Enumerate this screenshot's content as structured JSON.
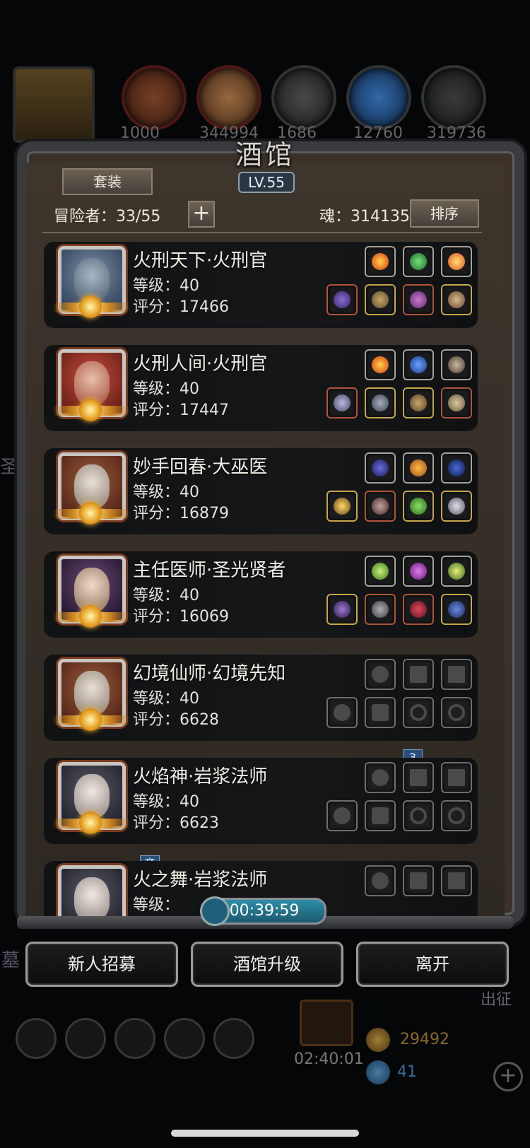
{
  "background": {
    "resources": [
      "1000",
      "344994",
      "1686",
      "12760",
      "319736"
    ],
    "side_text_left": "墓",
    "side_text_left2": "圣",
    "side_text_right": "出征",
    "gold": "29492",
    "gem": "41",
    "gift_timer": "02:40:01"
  },
  "tavern": {
    "title": "酒馆",
    "level": "LV.55",
    "set_button": "套装",
    "adventurers_label": "冒险者：33/55",
    "soul_label": "魂：314135",
    "sort_button": "排序",
    "timer": "00:39:59"
  },
  "heroes": [
    {
      "name": "火刑天下·火刑官",
      "level": "等级：40",
      "score": "评分：17466",
      "equipped": true
    },
    {
      "name": "火刑人间·火刑官",
      "level": "等级：40",
      "score": "评分：17447",
      "equipped": true
    },
    {
      "name": "妙手回春·大巫医",
      "level": "等级：40",
      "score": "评分：16879",
      "equipped": true
    },
    {
      "name": "主任医师·圣光贤者",
      "level": "等级：40",
      "score": "评分：16069",
      "equipped": true
    },
    {
      "name": "幻境仙师·幻境先知",
      "level": "等级：40",
      "score": "评分：6628",
      "equipped": false
    },
    {
      "name": "火焰神·岩浆法师",
      "level": "等级：40",
      "score": "评分：6623",
      "equipped": false
    },
    {
      "name": "火之舞·岩浆法师",
      "level": "等级：",
      "score": "",
      "equipped": false
    }
  ],
  "badges": {
    "rank3": "3",
    "arena": "竞"
  },
  "buttons": {
    "recruit": "新人招募",
    "upgrade": "酒馆升级",
    "leave": "离开"
  },
  "colors": {
    "frame": "#3a3b3e",
    "card": "#121416",
    "timer": "#2c8ea8",
    "medal": "#e59b1c"
  }
}
